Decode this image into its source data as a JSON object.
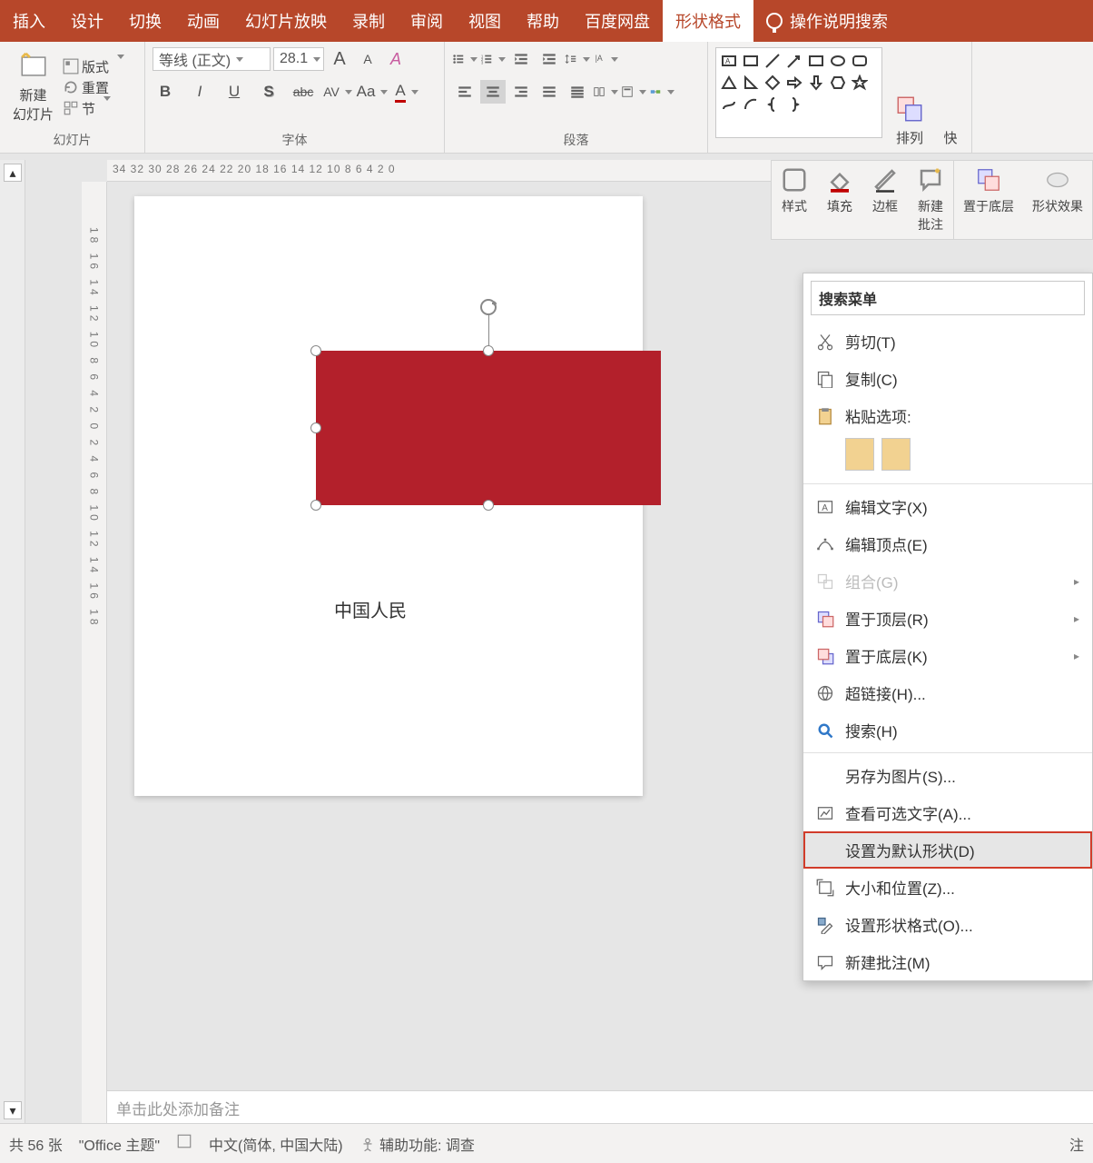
{
  "tabs": {
    "insert": "插入",
    "design": "设计",
    "transition": "切换",
    "animation": "动画",
    "slideshow": "幻灯片放映",
    "record": "录制",
    "review": "审阅",
    "view": "视图",
    "help": "帮助",
    "baidu": "百度网盘",
    "shapeFormat": "形状格式",
    "search": "操作说明搜索"
  },
  "ribbon": {
    "slides": {
      "new": "新建\n幻灯片",
      "layout": "版式",
      "reset": "重置",
      "section": "节",
      "label": "幻灯片"
    },
    "font": {
      "name": "等线 (正文)",
      "size": "28.1",
      "incA": "A",
      "decA": "A",
      "clear": "Aₐ",
      "b": "B",
      "i": "I",
      "u": "U",
      "s": "S",
      "strike": "abc",
      "spacing": "AV",
      "case": "Aa",
      "color": "A",
      "label": "字体"
    },
    "para": {
      "label": "段落"
    },
    "shapes": {
      "arrange": "排列",
      "quick": "快"
    }
  },
  "mini": {
    "style": "样式",
    "fill": "填充",
    "outline": "边框",
    "comment": "新建\n批注",
    "sendback": "置于底层",
    "effects": "形状效果"
  },
  "ruler": {
    "h": "34 32 30 28 26 24 22 20 18 16 14 12 10 8   6   4   2   0",
    "v": "18 16 14 12 10  8  6  4  2  0  2  4  6  8 10 12 14 16 18"
  },
  "slide": {
    "text": "中国人民"
  },
  "notes": {
    "placeholder": "单击此处添加备注"
  },
  "ctx": {
    "search": "搜索菜单",
    "cut": "剪切(T)",
    "copy": "复制(C)",
    "pasteOpt": "粘贴选项:",
    "editText": "编辑文字(X)",
    "editPoints": "编辑顶点(E)",
    "group": "组合(G)",
    "bringFront": "置于顶层(R)",
    "sendBack": "置于底层(K)",
    "hyperlink": "超链接(H)...",
    "searchItem": "搜索(H)",
    "saveAsPic": "另存为图片(S)...",
    "altText": "查看可选文字(A)...",
    "setDefault": "设置为默认形状(D)",
    "sizePos": "大小和位置(Z)...",
    "formatShape": "设置形状格式(O)...",
    "newComment": "新建批注(M)"
  },
  "status": {
    "count": "共 56 张",
    "theme": "\"Office 主题\"",
    "lang": "中文(简体, 中国大陆)",
    "a11y": "辅助功能: 调查",
    "notes": "注"
  }
}
